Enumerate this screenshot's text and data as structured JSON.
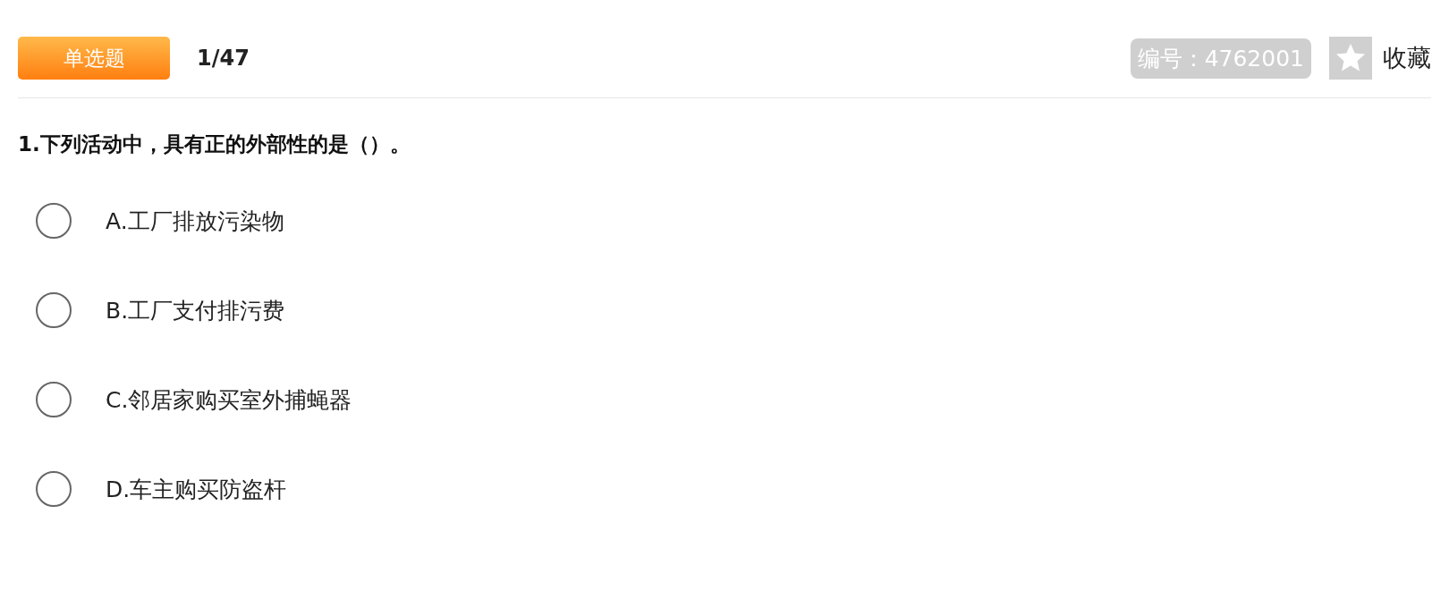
{
  "header": {
    "type_badge": "单选题",
    "progress": "1/47",
    "id_label": "编号：4762001",
    "favorite": {
      "label": "收藏",
      "favorited": false
    }
  },
  "question": {
    "text": "1.下列活动中，具有正的外部性的是（）。",
    "options": [
      {
        "label": "A.工厂排放污染物",
        "selected": false
      },
      {
        "label": "B.工厂支付排污费",
        "selected": false
      },
      {
        "label": "C.邻居家购买室外捕蝇器",
        "selected": false
      },
      {
        "label": "D.车主购买防盗杆",
        "selected": false
      }
    ]
  }
}
